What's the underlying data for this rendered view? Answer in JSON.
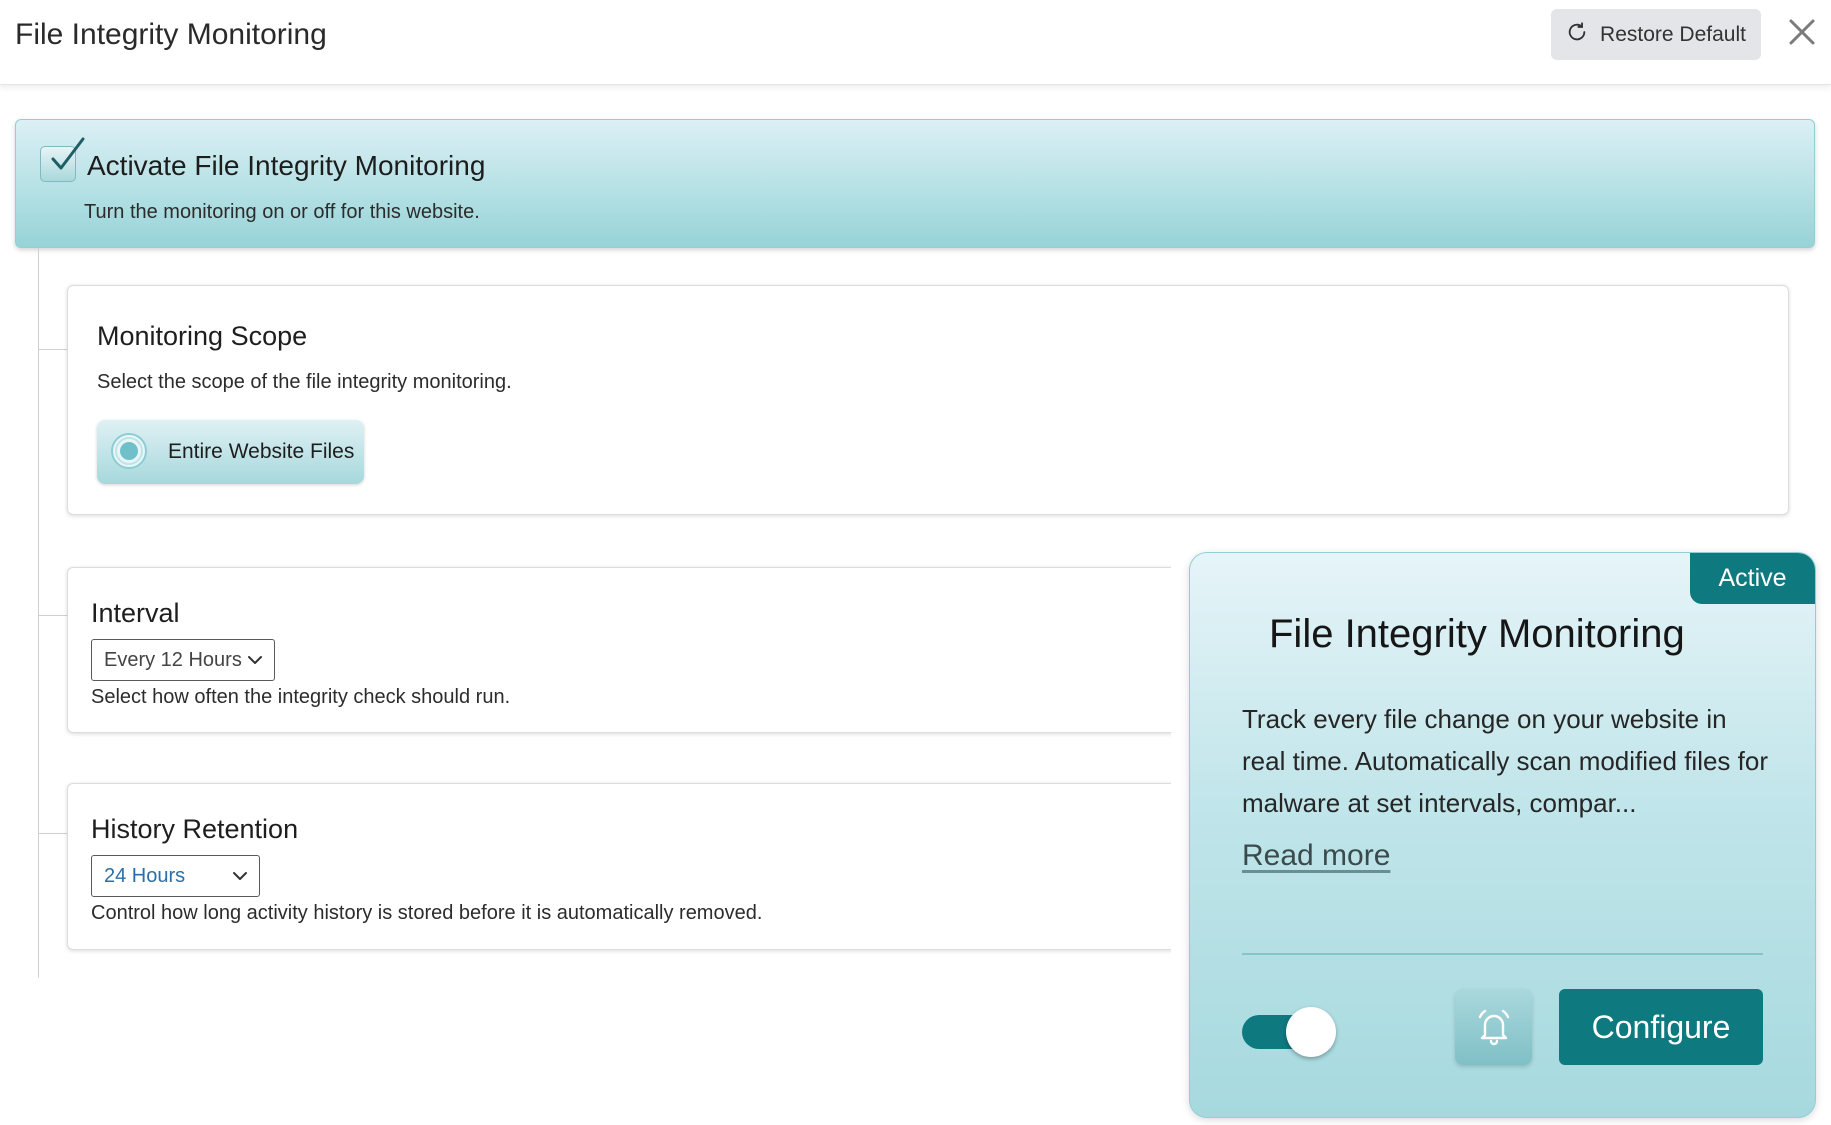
{
  "header": {
    "title": "File Integrity Monitoring",
    "restore_label": "Restore Default"
  },
  "activate": {
    "checked": true,
    "title": "Activate File Integrity Monitoring",
    "description": "Turn the monitoring on or off for this website."
  },
  "scope": {
    "title": "Monitoring Scope",
    "description": "Select the scope of the file integrity monitoring.",
    "selected_option": "Entire Website Files"
  },
  "interval": {
    "title": "Interval",
    "selected": "Every 12 Hours",
    "description": "Select how often the integrity check should run."
  },
  "retention": {
    "title": "History Retention",
    "selected": "24 Hours",
    "description": "Control how long activity history is stored before it is automatically removed."
  },
  "feature_card": {
    "badge": "Active",
    "title": "File Integrity Monitoring",
    "description": "Track every file change on your website in real time. Automatically scan modified files for malware at set intervals, compar...",
    "read_more": "Read more",
    "toggle_on": true,
    "configure_label": "Configure"
  },
  "colors": {
    "accent": "#0f7980",
    "panel_light": "#dcf0f5",
    "panel_dark": "#97d3d7"
  },
  "icons": {
    "restore": "refresh-icon",
    "close": "close-icon",
    "checkbox": "checkmark-icon",
    "radio": "radio-selected-icon",
    "select": "chevron-down-icon",
    "bell": "bell-icon"
  }
}
